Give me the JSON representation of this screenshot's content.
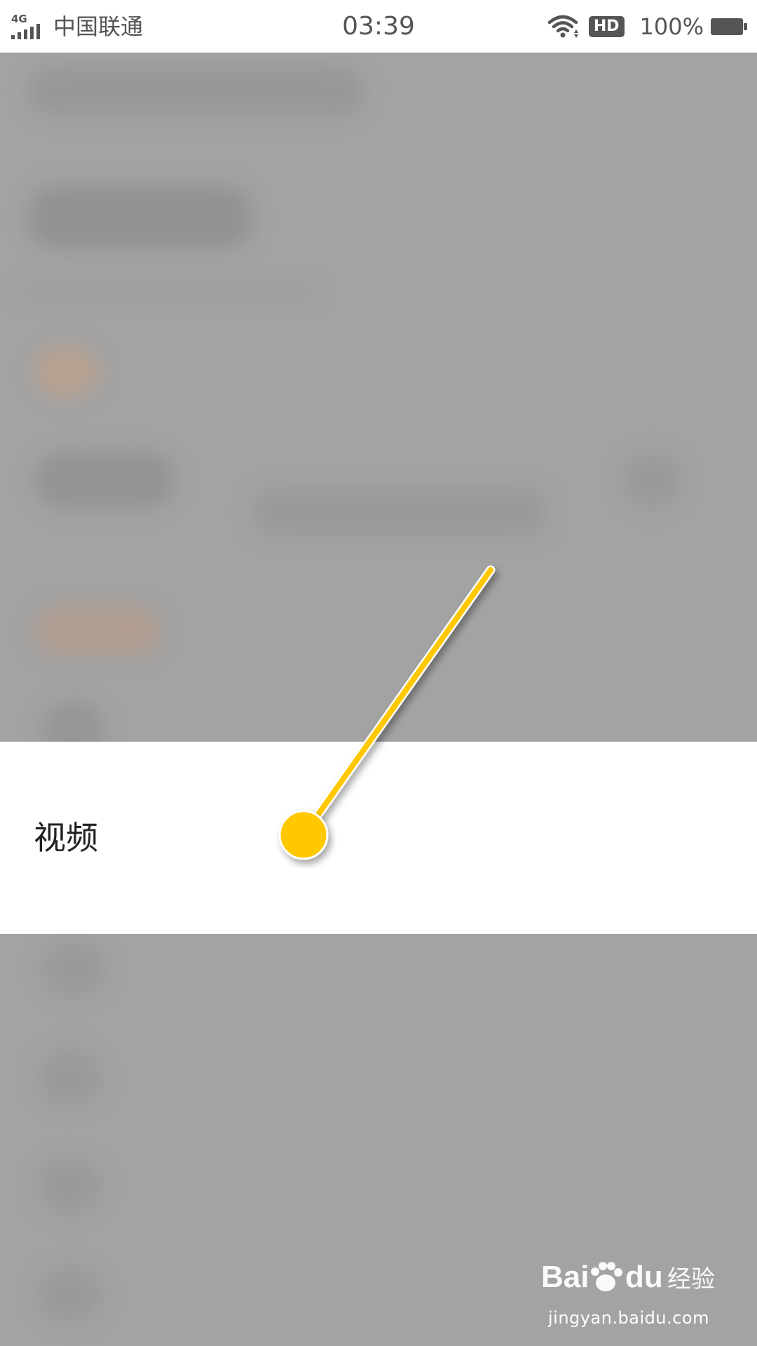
{
  "status_bar": {
    "network_type": "4G",
    "carrier": "中国联通",
    "time": "03:39",
    "hd_badge": "HD",
    "battery": "100%",
    "icons": [
      "signal-icon",
      "wifi-icon",
      "battery-icon"
    ]
  },
  "highlight": {
    "label": "视频"
  },
  "pointer": {
    "color": "#ffc800"
  },
  "watermark": {
    "brand": "Baidu经验",
    "url": "jingyan.baidu.com"
  }
}
